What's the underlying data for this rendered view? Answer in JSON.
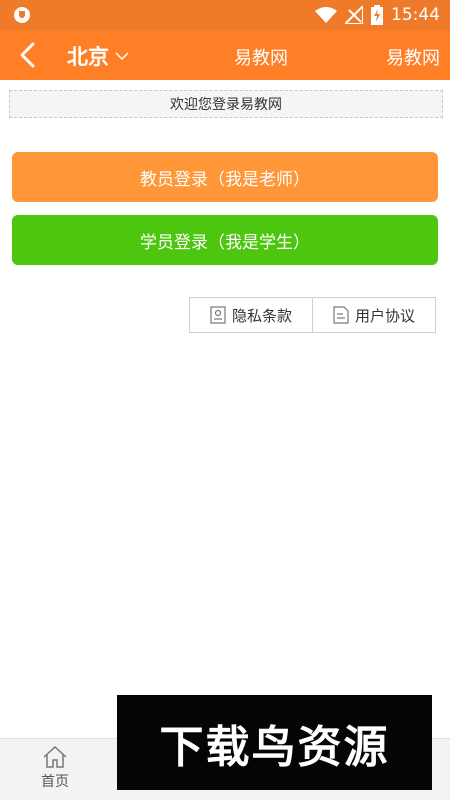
{
  "status_bar": {
    "time": "15:44",
    "icons": [
      "shield-icon",
      "wifi-icon",
      "no-signal-icon",
      "battery-charging-icon"
    ]
  },
  "top_bar": {
    "city": "北京",
    "title": "易教网",
    "right_label": "易教网",
    "background_color": "#ff7f27"
  },
  "welcome": {
    "text": "欢迎您登录易教网"
  },
  "login": {
    "teacher_label": "教员登录（我是老师）",
    "student_label": "学员登录（我是学生）",
    "teacher_color": "#ff9638",
    "student_color": "#4cc60e"
  },
  "links": {
    "privacy": "隐私条款",
    "agreement": "用户协议"
  },
  "bottom_nav": {
    "home_label": "首页"
  },
  "watermark": {
    "text": "下载鸟资源"
  }
}
